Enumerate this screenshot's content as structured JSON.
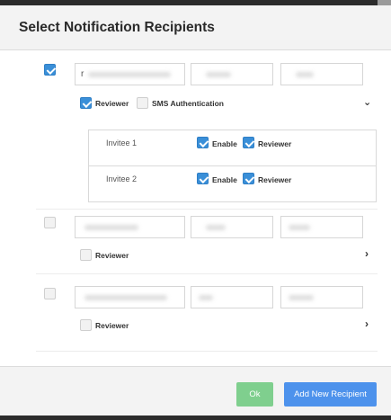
{
  "dialog": {
    "title": "Select Notification Recipients"
  },
  "recipients": [
    {
      "selected": true,
      "name_value": "r",
      "reviewer_label": "Reviewer",
      "reviewer_checked": true,
      "sms_label": "SMS Authentication",
      "sms_checked": false,
      "expanded": true,
      "chevron_icon": "chevron-down-icon",
      "invitees": [
        {
          "name": "Invitee 1",
          "enable_label": "Enable",
          "enable_checked": true,
          "reviewer_label": "Reviewer",
          "reviewer_checked": true
        },
        {
          "name": "Invitee 2",
          "enable_label": "Enable",
          "enable_checked": true,
          "reviewer_label": "Reviewer",
          "reviewer_checked": true
        }
      ]
    },
    {
      "selected": false,
      "reviewer_label": "Reviewer",
      "reviewer_checked": false,
      "expanded": false,
      "chevron_icon": "chevron-right-icon"
    },
    {
      "selected": false,
      "reviewer_label": "Reviewer",
      "reviewer_checked": false,
      "expanded": false,
      "chevron_icon": "chevron-right-icon"
    }
  ],
  "footer": {
    "ok_label": "Ok",
    "add_label": "Add New Recipient"
  },
  "colors": {
    "accent": "#3a8fd8",
    "ok_button": "#7fcf8e",
    "add_button": "#4d92ec",
    "header_bg": "#f3f3f3"
  }
}
